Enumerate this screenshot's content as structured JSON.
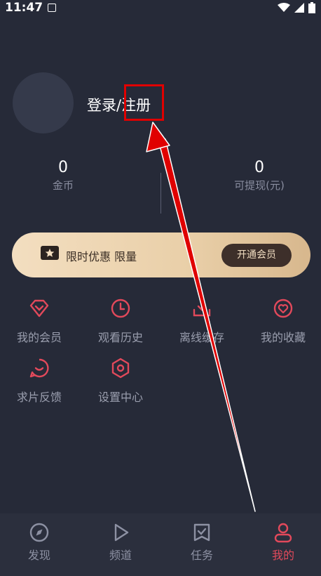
{
  "status_bar": {
    "time": "11:47"
  },
  "profile": {
    "login_label": "登录/注册"
  },
  "stats": [
    {
      "value": "0",
      "label": "金币"
    },
    {
      "value": "0",
      "label": "可提现(元)"
    }
  ],
  "vip": {
    "promo_text": "限时优惠 限量",
    "button_label": "开通会员"
  },
  "menu": [
    {
      "label": "我的会员",
      "icon": "diamond-icon"
    },
    {
      "label": "观看历史",
      "icon": "clock-icon"
    },
    {
      "label": "离线缓存",
      "icon": "download-icon"
    },
    {
      "label": "我的收藏",
      "icon": "heart-icon"
    },
    {
      "label": "求片反馈",
      "icon": "feedback-icon"
    },
    {
      "label": "设置中心",
      "icon": "settings-icon"
    }
  ],
  "tabs": [
    {
      "label": "发现",
      "icon": "compass-icon",
      "active": false
    },
    {
      "label": "频道",
      "icon": "play-icon",
      "active": false
    },
    {
      "label": "任务",
      "icon": "task-icon",
      "active": false
    },
    {
      "label": "我的",
      "icon": "user-icon",
      "active": true
    }
  ],
  "colors": {
    "background": "#262a38",
    "accent": "#e2495b",
    "annotation": "#e00000"
  }
}
